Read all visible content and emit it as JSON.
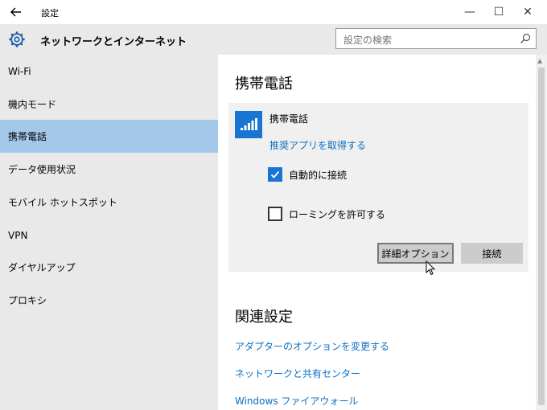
{
  "window": {
    "title": "設定",
    "back_icon": "back-arrow-icon",
    "controls": {
      "minimize": "—",
      "maximize": "☐",
      "close": "✕"
    }
  },
  "header": {
    "title": "ネットワークとインターネット",
    "icon": "gear-icon",
    "search": {
      "placeholder": "設定の検索",
      "value": "",
      "icon": "search-icon"
    }
  },
  "sidebar": {
    "items": [
      {
        "label": "Wi-Fi",
        "selected": false
      },
      {
        "label": "機内モード",
        "selected": false
      },
      {
        "label": "携帯電話",
        "selected": true
      },
      {
        "label": "データ使用状況",
        "selected": false
      },
      {
        "label": "モバイル ホットスポット",
        "selected": false
      },
      {
        "label": "VPN",
        "selected": false
      },
      {
        "label": "ダイヤルアップ",
        "selected": false
      },
      {
        "label": "プロキシ",
        "selected": false
      }
    ]
  },
  "main": {
    "title": "携帯電話",
    "card": {
      "name": "携帯電話",
      "icon": "signal-bars-icon",
      "link": "推奨アプリを取得する",
      "auto_connect": {
        "label": "自動的に接続",
        "checked": true
      },
      "roaming": {
        "label": "ローミングを許可する",
        "checked": false
      },
      "advanced_button": "詳細オプション",
      "connect_button": "接続"
    },
    "related": {
      "title": "関連設定",
      "links": [
        "アダプターのオプションを変更する",
        "ネットワークと共有センター",
        "Windows ファイアウォール"
      ]
    }
  },
  "colors": {
    "accent": "#1876d2",
    "link": "#0a6fc2",
    "selected_nav": "#a3c8ea",
    "sidebar_bg": "#e9e9e9",
    "card_bg": "#f0f0f0"
  }
}
